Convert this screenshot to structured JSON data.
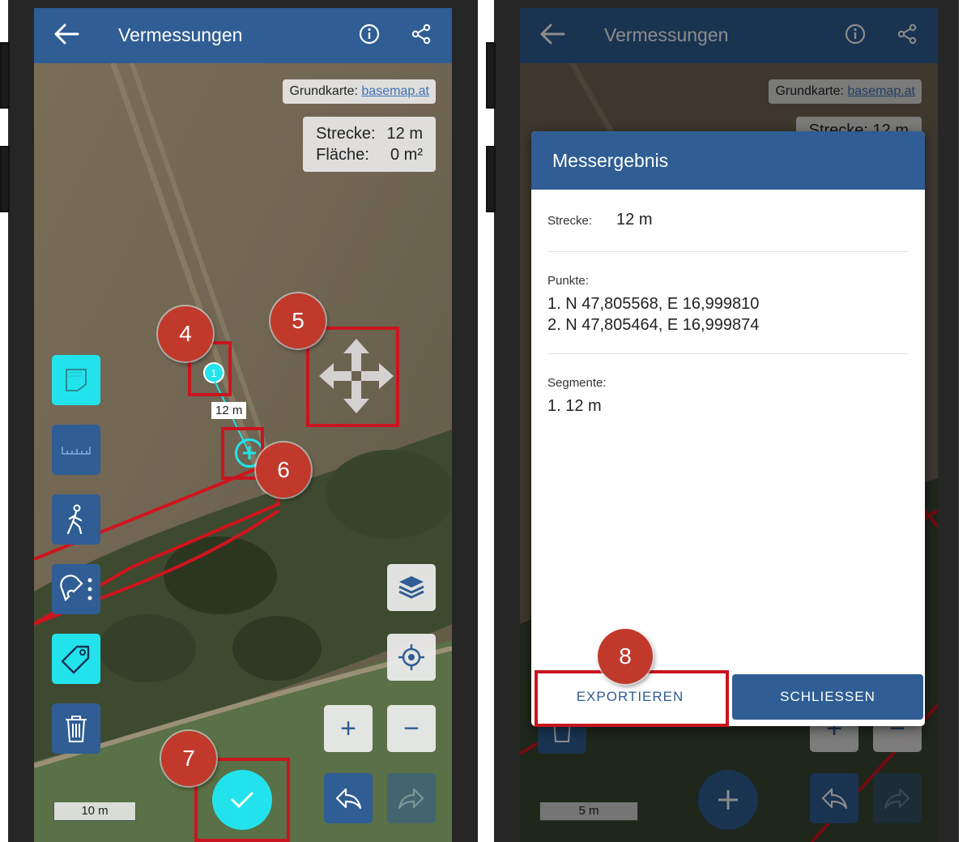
{
  "left": {
    "app_title": "Vermessungen",
    "attribution_prefix": "Grundkarte:",
    "attribution_link": "basemap.at",
    "strecke_label": "Strecke:",
    "strecke_value": "12 m",
    "flaeche_label": "Fläche:",
    "flaeche_value": "0 m²",
    "point_label": "1",
    "segment_label": "12 m",
    "scale_label": "10 m",
    "markers": [
      "4",
      "5",
      "6",
      "7"
    ],
    "zoom_in": "+",
    "zoom_out": "−"
  },
  "right": {
    "app_title": "Vermessungen",
    "attribution_prefix": "Grundkarte:",
    "attribution_link": "basemap.at",
    "strecke_partial": "Strecke:   12 m",
    "dialog_title": "Messergebnis",
    "strecke_label": "Strecke:",
    "strecke_value": "12 m",
    "punkte_label": "Punkte:",
    "punkte": [
      "1. N 47,805568, E 16,999810",
      "2. N 47,805464, E 16,999874"
    ],
    "segmente_label": "Segmente:",
    "segmente": [
      "1. 12 m"
    ],
    "export_button": "EXPORTIEREN",
    "close_button": "SCHLIESSEN",
    "scale_label": "5 m",
    "marker": "8",
    "zoom_in": "+",
    "zoom_out": "−"
  },
  "colors": {
    "app_bar": "#2f5d94",
    "accent_cyan": "#22e3ec",
    "marker_red": "#c0392b",
    "highlight_red": "#c9151f",
    "measure_line_red": "#d0141d"
  },
  "icons": [
    "back-arrow-icon",
    "info-icon",
    "share-icon",
    "polygon-icon",
    "ruler-icon",
    "walk-icon",
    "magnet-icon",
    "tag-icon",
    "trash-icon",
    "layers-icon",
    "locate-icon",
    "undo-icon",
    "redo-icon",
    "check-icon",
    "move-icon",
    "add-point-icon"
  ]
}
